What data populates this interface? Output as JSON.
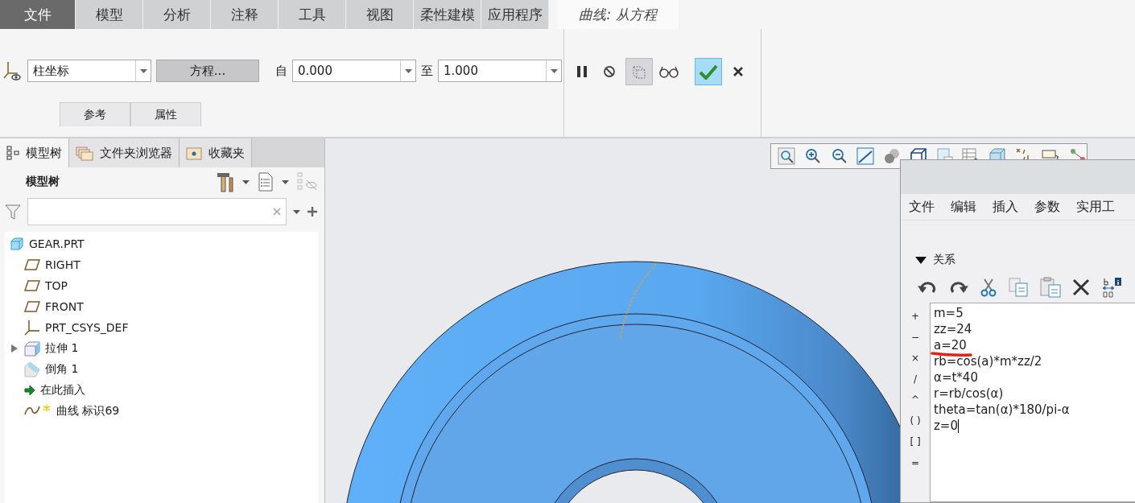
{
  "ribbon_tabs": [
    {
      "label": "文件",
      "kind": "file",
      "selected": false
    },
    {
      "label": "模型",
      "kind": "normal",
      "selected": false
    },
    {
      "label": "分析",
      "kind": "normal",
      "selected": false
    },
    {
      "label": "注释",
      "kind": "normal",
      "selected": false
    },
    {
      "label": "工具",
      "kind": "normal",
      "selected": false
    },
    {
      "label": "视图",
      "kind": "normal",
      "selected": false
    },
    {
      "label": "柔性建模",
      "kind": "normal",
      "selected": false
    },
    {
      "label": "应用程序",
      "kind": "normal",
      "selected": false
    },
    {
      "label": "曲线: 从方程",
      "kind": "context",
      "selected": true
    }
  ],
  "curve_toolbar": {
    "coordinate_system": "柱坐标",
    "equation_button": "方程...",
    "from_label": "自",
    "from_value": "0.000",
    "to_label": "至",
    "to_value": "1.000",
    "actions": [
      {
        "kind": "pause",
        "pressed": false
      },
      {
        "kind": "stop",
        "pressed": false
      },
      {
        "kind": "preview",
        "pressed": true
      },
      {
        "kind": "glasses",
        "pressed": false
      },
      {
        "kind": "ok",
        "pressed": true
      },
      {
        "kind": "cancel",
        "pressed": false
      }
    ],
    "panel_tabs": [
      "参考",
      "属性"
    ]
  },
  "left_panel": {
    "tabs": [
      {
        "label": "模型树",
        "kind": "tree",
        "selected": true
      },
      {
        "label": "文件夹浏览器",
        "kind": "folders",
        "selected": false
      },
      {
        "label": "收藏夹",
        "kind": "favorites",
        "selected": false
      }
    ],
    "header": "模型树",
    "tree": [
      {
        "label": "GEAR.PRT",
        "kind": "part",
        "expandable": false,
        "children": [
          {
            "label": "RIGHT",
            "kind": "plane",
            "expandable": false
          },
          {
            "label": "TOP",
            "kind": "plane",
            "expandable": false
          },
          {
            "label": "FRONT",
            "kind": "plane",
            "expandable": false
          },
          {
            "label": "PRT_CSYS_DEF",
            "kind": "csys",
            "expandable": false
          },
          {
            "label": "拉伸 1",
            "kind": "extrude",
            "expandable": true
          },
          {
            "label": "倒角 1",
            "kind": "chamfer",
            "expandable": false
          },
          {
            "label": "在此插入",
            "kind": "insert",
            "expandable": false
          },
          {
            "label": "曲线 标识69",
            "kind": "curve",
            "expandable": false
          }
        ]
      }
    ]
  },
  "relations_dialog": {
    "menu": [
      "文件",
      "编辑",
      "插入",
      "参数",
      "实用工"
    ],
    "section": "关系",
    "section_expanded": true,
    "operators": [
      "+",
      "−",
      "×",
      "/",
      "^",
      "( )",
      "[ ]",
      "="
    ],
    "lines": [
      {
        "text": "m=5",
        "underlined": false
      },
      {
        "text": "zz=24",
        "underlined": false
      },
      {
        "text": "a=20",
        "underlined": true
      },
      {
        "text": "rb=cos(a)*m*zz/2",
        "underlined": false
      },
      {
        "text": "α=t*40",
        "underlined": false
      },
      {
        "text": "r=rb/cos(α)",
        "underlined": false
      },
      {
        "text": "theta=tan(α)*180/pi-α",
        "underlined": false
      },
      {
        "text": "z=0",
        "underlined": false
      }
    ]
  }
}
